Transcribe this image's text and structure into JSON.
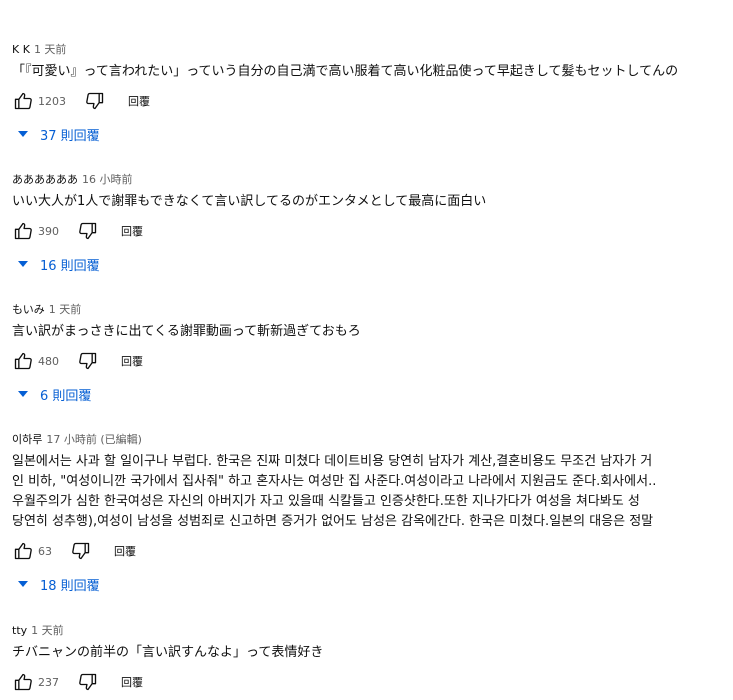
{
  "comments": [
    {
      "author": "K K",
      "time": "1 天前",
      "text": [
        "「『可愛い』って言われたい」っていう自分の自己満で高い服着て高い化粧品使って早起きして髪もセットしてんの"
      ],
      "likes": "1203",
      "reply_label": "回覆",
      "replies_label": "37 則回覆"
    },
    {
      "author": "ああああああ",
      "time": "16 小時前",
      "text": [
        "いい大人が1人で謝罪もできなくて言い訳してるのがエンタメとして最高に面白い"
      ],
      "likes": "390",
      "reply_label": "回覆",
      "replies_label": "16 則回覆"
    },
    {
      "author": "もいみ",
      "time": "1 天前",
      "text": [
        "言い訳がまっさきに出てくる謝罪動画って斬新過ぎておもろ"
      ],
      "likes": "480",
      "reply_label": "回覆",
      "replies_label": "6 則回覆"
    },
    {
      "author": "이하루",
      "time": "17 小時前 (已編輯)",
      "text": [
        "일본에서는 사과 할 일이구나 부럽다. 한국은 진짜 미쳤다 데이트비용 당연히 남자가 계산,결혼비용도 무조건 남자가 거",
        "인 비하, \"여성이니깐 국가에서 집사줘\" 하고 혼자사는 여성만 집 사준다.여성이라고 나라에서 지원금도 준다.회사에서..",
        "우월주의가 심한 한국여성은 자신의 아버지가 자고 있을때 식칼들고 인증샷한다.또한 지나가다가 여성을 쳐다봐도 성",
        "당연히 성추행),여성이 남성을 성범죄로 신고하면 증거가 없어도 남성은 감옥에간다. 한국은 미쳤다.일본의 대응은 정말"
      ],
      "likes": "63",
      "reply_label": "回覆",
      "replies_label": "18 則回覆"
    },
    {
      "author": "tty",
      "time": "1 天前",
      "text": [
        "チバニャンの前半の「言い訳すんなよ」って表情好き"
      ],
      "likes": "237",
      "reply_label": "回覆",
      "replies_label": ""
    }
  ]
}
